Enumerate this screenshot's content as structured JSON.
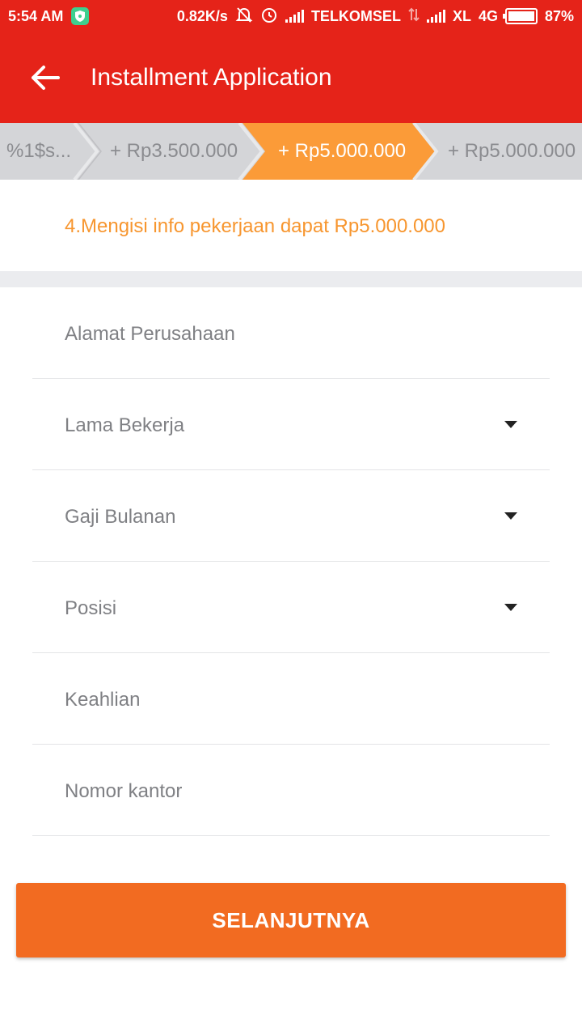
{
  "status_bar": {
    "time": "5:54 AM",
    "net_speed": "0.82K/s",
    "carrier1": "TELKOMSEL",
    "carrier2": "XL",
    "network_type": "4G",
    "battery": "87%",
    "icons": [
      "shield-icon",
      "bell-muted-icon",
      "alarm-icon",
      "signal-icon",
      "data-arrows-icon",
      "signal-icon",
      "battery-icon"
    ]
  },
  "app_bar": {
    "title": "Installment Application",
    "back_icon": "arrow-left-icon"
  },
  "steps": {
    "items": [
      {
        "label": "%1$s...",
        "state": "done"
      },
      {
        "label": "+ Rp3.500.000",
        "state": "done"
      },
      {
        "label": "+ Rp5.000.000",
        "state": "active"
      },
      {
        "label": "+ Rp5.000.000",
        "state": "upcoming"
      }
    ],
    "colors": {
      "inactive_bg": "#d4d5d8",
      "active_bg": "#fb9b38",
      "divider": "#ffffff"
    }
  },
  "banner": {
    "text": "4.Mengisi info pekerjaan dapat Rp5.000.000"
  },
  "form": {
    "fields": [
      {
        "label": "Alamat Perusahaan",
        "type": "text"
      },
      {
        "label": "Lama Bekerja",
        "type": "select"
      },
      {
        "label": "Gaji Bulanan",
        "type": "select"
      },
      {
        "label": "Posisi",
        "type": "select"
      },
      {
        "label": "Keahlian",
        "type": "text"
      },
      {
        "label": "Nomor kantor",
        "type": "text"
      }
    ]
  },
  "submit": {
    "label": "SELANJUTNYA"
  },
  "colors": {
    "primary": "#e52319",
    "accent": "#f7962f",
    "button": "#f26b21"
  }
}
